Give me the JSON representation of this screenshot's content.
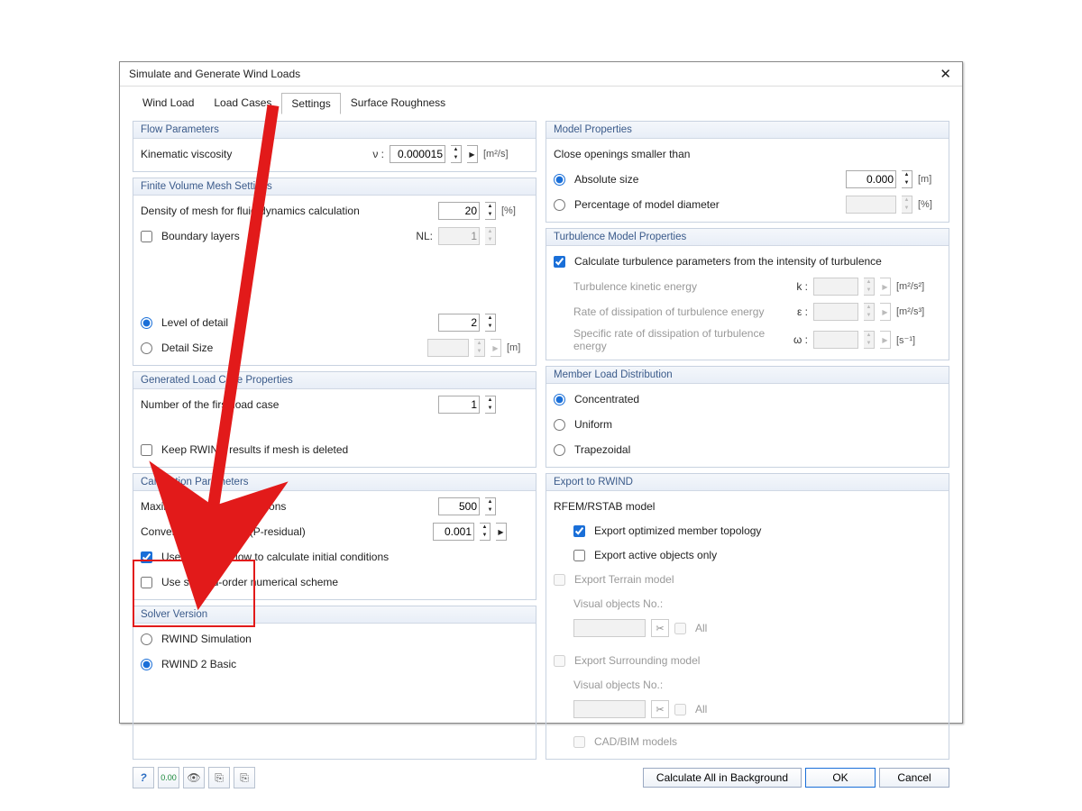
{
  "title": "Simulate and Generate Wind Loads",
  "tabs": [
    "Wind Load",
    "Load Cases",
    "Settings",
    "Surface Roughness"
  ],
  "activeTab": "Settings",
  "flowParams": {
    "header": "Flow Parameters",
    "kinematicViscosityLabel": "Kinematic viscosity",
    "kinematicViscositySym": "ν :",
    "kinematicViscosityVal": "0.000015",
    "kinematicViscosityUnit": "[m²/s]"
  },
  "fvm": {
    "header": "Finite Volume Mesh Settings",
    "densityLabel": "Density of mesh for fluid dynamics calculation",
    "densityVal": "20",
    "densityUnit": "[%]",
    "boundaryLayersLabel": "Boundary layers",
    "boundaryLayersNLSym": "NL:",
    "boundaryLayersNLVal": "1",
    "lodLabel": "Level of detail",
    "lodVal": "2",
    "detailSizeLabel": "Detail Size",
    "detailSizeUnit": "[m]"
  },
  "genLoad": {
    "header": "Generated Load Case Properties",
    "numberLabel": "Number of the first load case",
    "numberVal": "1",
    "keepLabel": "Keep RWIND results if mesh is deleted"
  },
  "calc": {
    "header": "Calculation Parameters",
    "maxIterLabel": "Maximum number of iterations",
    "maxIterVal": "500",
    "convLabel": "Convergence criterion (P-residual)",
    "convVal": "0.001",
    "usePotentialLabel": "Use Potential Flow to calculate initial conditions",
    "useSecondOrderLabel": "Use second-order numerical scheme"
  },
  "solver": {
    "header": "Solver Version",
    "opt1": "RWIND Simulation",
    "opt2": "RWIND 2 Basic"
  },
  "modelProps": {
    "header": "Model Properties",
    "closeOpeningsLabel": "Close openings smaller than",
    "absoluteLabel": "Absolute size",
    "absoluteVal": "0.000",
    "absoluteUnit": "[m]",
    "percentLabel": "Percentage of model diameter",
    "percentUnit": "[%]"
  },
  "turb": {
    "header": "Turbulence Model Properties",
    "calcLabel": "Calculate turbulence parameters from the intensity of turbulence",
    "tkeLabel": "Turbulence kinetic energy",
    "tkeSym": "k :",
    "tkeUnit": "[m²/s²]",
    "rdeLabel": "Rate of dissipation of turbulence energy",
    "rdeSym": "ε :",
    "rdeUnit": "[m²/s³]",
    "srdeLabel": "Specific rate of dissipation of turbulence energy",
    "srdeSym": "ω :",
    "srdeUnit": "[s⁻¹]"
  },
  "memberLoad": {
    "header": "Member Load Distribution",
    "opt1": "Concentrated",
    "opt2": "Uniform",
    "opt3": "Trapezoidal"
  },
  "export": {
    "header": "Export to RWIND",
    "modelLabel": "RFEM/RSTAB model",
    "optTopLabel": "Export optimized member topology",
    "activeLabel": "Export active objects only",
    "terrainLabel": "Export Terrain model",
    "visualObjLabel": "Visual objects No.:",
    "allLabel": "All",
    "surroundingLabel": "Export Surrounding model",
    "cadbimLabel": "CAD/BIM models"
  },
  "footer": {
    "calcBg": "Calculate All in Background",
    "ok": "OK",
    "cancel": "Cancel"
  }
}
